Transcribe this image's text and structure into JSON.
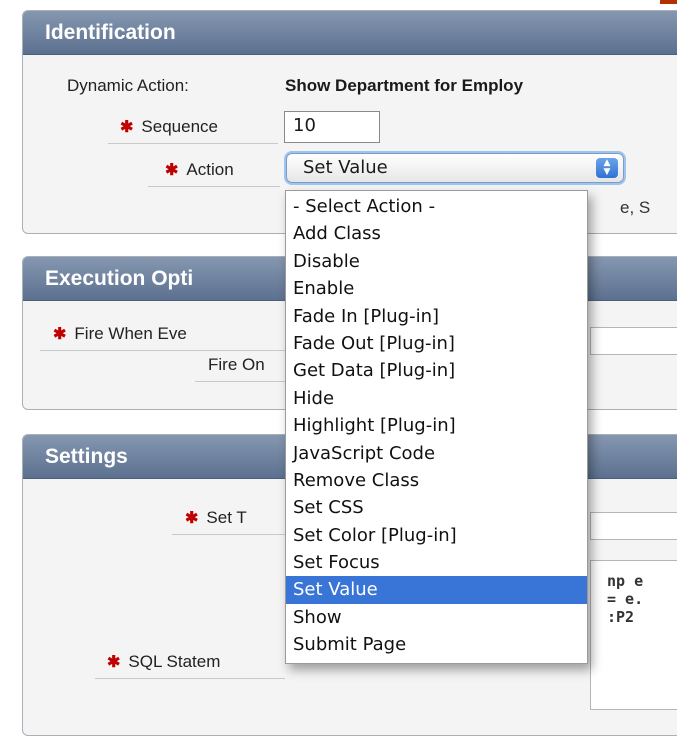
{
  "identification": {
    "title": "Identification",
    "dynamic_action_label": "Dynamic Action:",
    "dynamic_action_value": "Show Department for Employ",
    "right_fragment": "e, S",
    "sequence": {
      "label": "Sequence",
      "value": "10"
    },
    "action": {
      "label": "Action",
      "selected": "Set Value"
    }
  },
  "execution_options": {
    "title": "Execution Opti",
    "fire_when_event": {
      "label": "Fire When Eve"
    },
    "fire_on": {
      "label": "Fire On"
    }
  },
  "settings": {
    "title": "Settings",
    "set_type": {
      "label": "Set T"
    },
    "sql_statement": {
      "label": "SQL Statem",
      "code_lines": [
        "np e",
        "= e.",
        ":P2"
      ]
    }
  },
  "action_dropdown": {
    "options": [
      "- Select Action -",
      "Add Class",
      "Disable",
      "Enable",
      "Fade In [Plug-in]",
      "Fade Out [Plug-in]",
      "Get Data [Plug-in]",
      "Hide",
      "Highlight [Plug-in]",
      "JavaScript Code",
      "Remove Class",
      "Set CSS",
      "Set Color [Plug-in]",
      "Set Focus",
      "Set Value",
      "Show",
      "Submit Page"
    ],
    "selected_index": 14
  },
  "colors": {
    "header_gradient_top": "#8597b0",
    "header_gradient_bottom": "#5c7190",
    "required_marker": "#c00000",
    "selection_highlight": "#3875d7"
  },
  "icons": {
    "required": "asterisk-icon",
    "select_arrows": "updown-arrows-icon"
  }
}
